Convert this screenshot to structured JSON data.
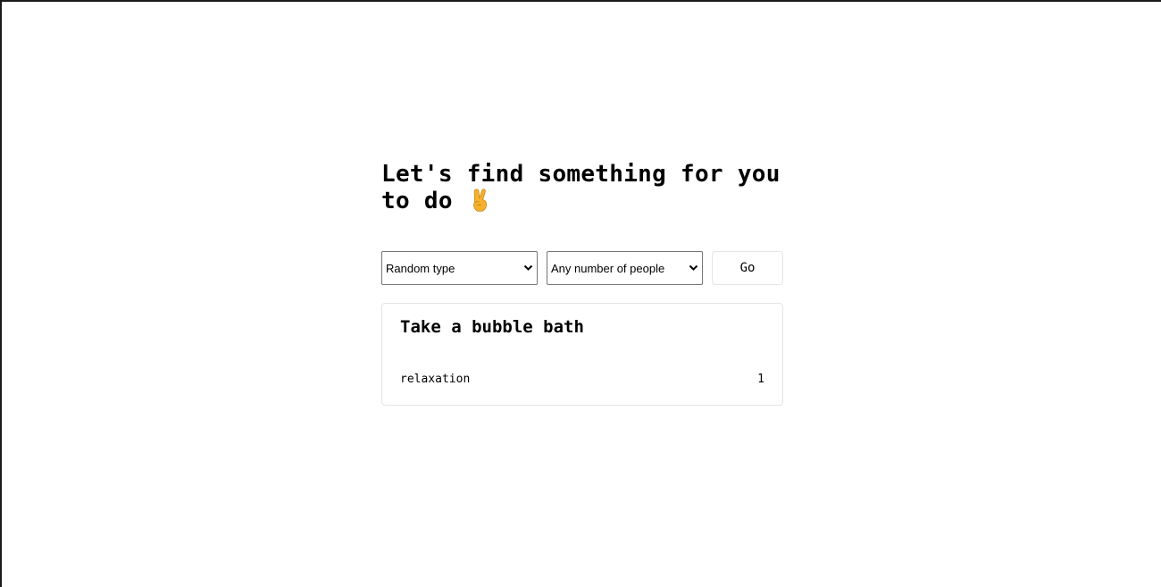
{
  "header": {
    "title": "Let's find something for you to do",
    "title_icon": "victory-hand-icon"
  },
  "filters": {
    "type_select": {
      "selected": "Random type",
      "icon": "chevron-down-icon"
    },
    "participants_select": {
      "selected": "Any number of people",
      "icon": "chevron-down-icon"
    },
    "go_label": "Go"
  },
  "activity": {
    "title": "Take a bubble bath",
    "type": "relaxation",
    "participants": "1"
  },
  "colors": {
    "text": "#000000",
    "border": "#e4e4e4",
    "select_border": "#767676",
    "emoji": "#f5b12e"
  }
}
